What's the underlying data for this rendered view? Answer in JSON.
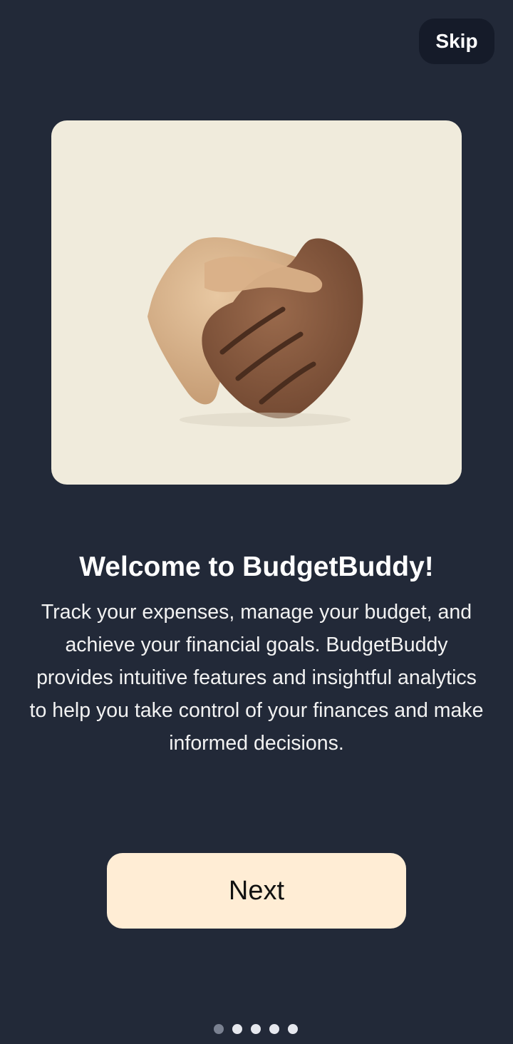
{
  "header": {
    "skip_label": "Skip"
  },
  "hero": {
    "image_name": "handshake-illustration",
    "card_color": "#f0ebdc"
  },
  "content": {
    "title": "Welcome to BudgetBuddy!",
    "description": "Track your expenses, manage your budget, and achieve your financial goals. BudgetBuddy provides intuitive features and insightful analytics to help you take control of your finances and make informed decisions."
  },
  "actions": {
    "next_label": "Next"
  },
  "pagination": {
    "total": 5,
    "current": 1
  },
  "colors": {
    "background": "#222938",
    "skip_button": "#151b29",
    "next_button": "#ffedd5",
    "dot_active": "#7a8191",
    "dot_inactive": "#e6e8ee"
  }
}
